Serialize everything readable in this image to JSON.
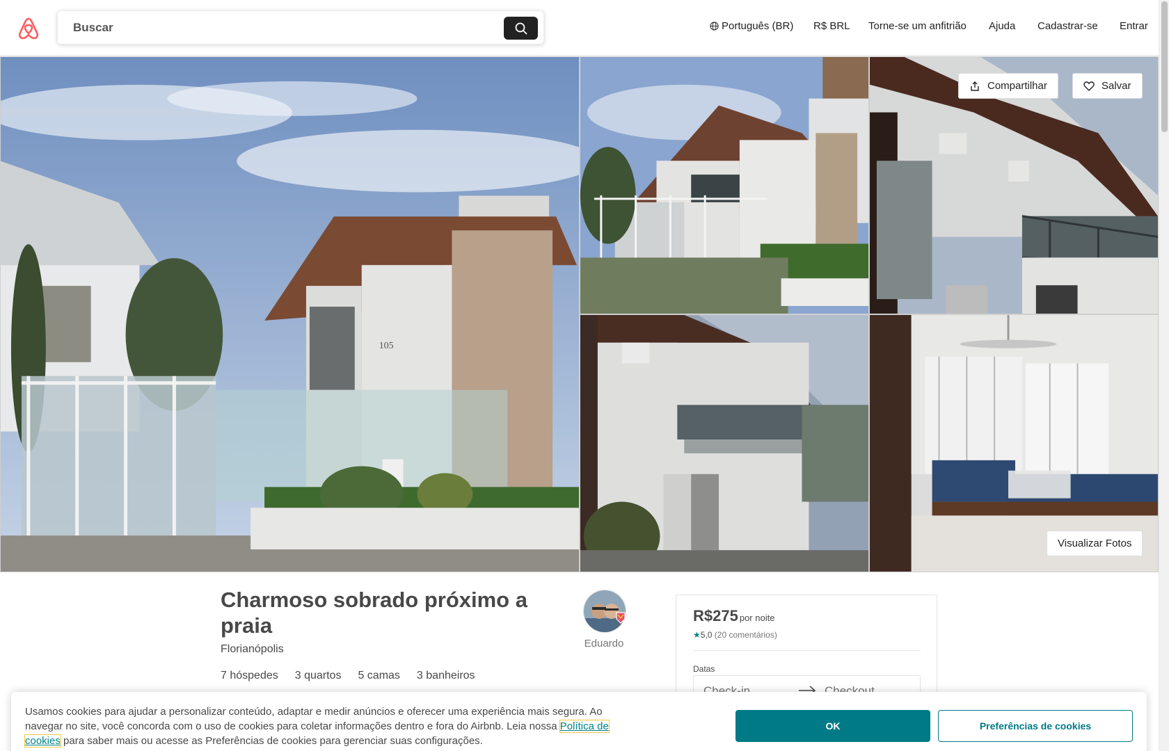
{
  "header": {
    "logo_icon": "airbnb-logo-icon",
    "search_placeholder": "Buscar",
    "nav": {
      "language": "Português (BR)",
      "currency": "R$ BRL",
      "host": "Torne-se um anfitrião",
      "help": "Ajuda",
      "signup": "Cadastrar-se",
      "login": "Entrar"
    }
  },
  "gallery": {
    "share_label": "Compartilhar",
    "save_label": "Salvar",
    "view_photos_label": "Visualizar Fotos",
    "house_number": "105"
  },
  "listing": {
    "title": "Charmoso sobrado próximo a praia",
    "location": "Florianópolis",
    "facts": [
      "7 hóspedes",
      "3 quartos",
      "5 camas",
      "3 banheiros"
    ],
    "host_name": "Eduardo"
  },
  "booking": {
    "price": "R$275",
    "price_unit": "por noite",
    "rating_value": "5,0",
    "reviews": "(20 comentários)",
    "dates_label": "Datas",
    "checkin_placeholder": "Check-in",
    "checkout_placeholder": "Checkout"
  },
  "cookie": {
    "text_before": "Usamos cookies para ajudar a personalizar conteúdo, adaptar e medir anúncios e oferecer uma experiência mais segura. Ao navegar no site, você concorda com o uso de cookies para coletar informações dentro e fora do Airbnb. Leia nossa ",
    "link_text": "Política de cookies",
    "text_after": " para saber mais ou acesse as Preferências de cookies para gerenciar suas configurações.",
    "ok_label": "OK",
    "prefs_label": "Preferências de cookies"
  },
  "colors": {
    "brand": "#FF5A5F",
    "teal": "#007A87",
    "text": "#484848"
  }
}
